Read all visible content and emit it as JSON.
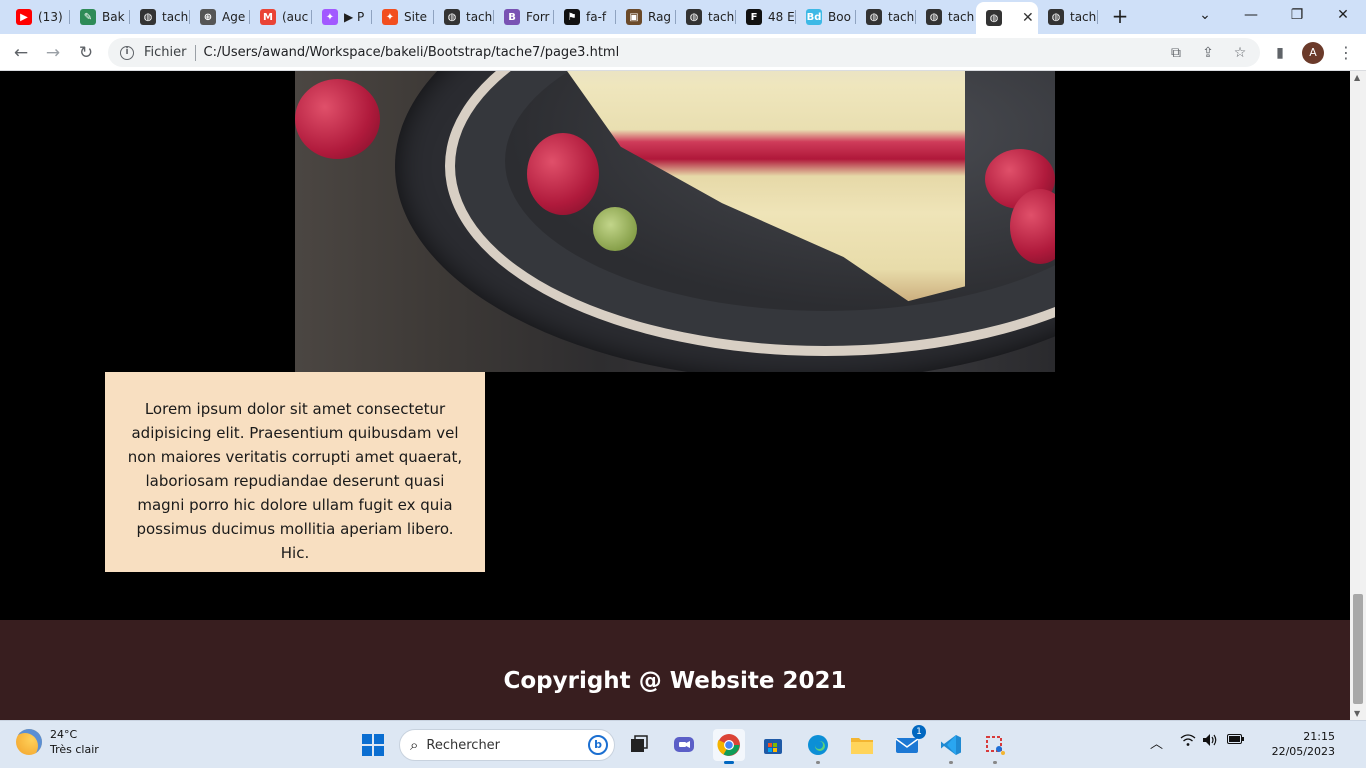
{
  "browser": {
    "tabs": [
      {
        "title": "(13)",
        "icon": "youtube-icon",
        "color": "#ff0000"
      },
      {
        "title": "Bak",
        "icon": "bakeli-icon",
        "color": "#2e8b57"
      },
      {
        "title": "tach",
        "icon": "globe-icon",
        "color": "#333333"
      },
      {
        "title": "Age",
        "icon": "web-icon",
        "color": "#333333"
      },
      {
        "title": "(auc",
        "icon": "gmail-icon",
        "color": "#ea4335"
      },
      {
        "title": "▶ P",
        "icon": "figma-icon",
        "color": "#a259ff"
      },
      {
        "title": "Site",
        "icon": "figma-icon",
        "color": "#f24e1e"
      },
      {
        "title": "tach",
        "icon": "globe-icon",
        "color": "#333333"
      },
      {
        "title": "Forr",
        "icon": "bootstrap-icon",
        "color": "#7952b3"
      },
      {
        "title": "fa-f",
        "icon": "flag-icon",
        "color": "#111111"
      },
      {
        "title": "Rag",
        "icon": "image-icon",
        "color": "#6b4a2a"
      },
      {
        "title": "tach",
        "icon": "globe-icon",
        "color": "#333333"
      },
      {
        "title": "48 E",
        "icon": "font-icon",
        "color": "#111111"
      },
      {
        "title": "Boo",
        "icon": "bd-icon",
        "color": "#3db9e6"
      },
      {
        "title": "tach",
        "icon": "globe-icon",
        "color": "#333333"
      },
      {
        "title": "tach",
        "icon": "globe-icon",
        "color": "#333333"
      },
      {
        "title": "",
        "icon": "globe-icon",
        "color": "#333333",
        "active": true
      },
      {
        "title": "tach",
        "icon": "globe-icon",
        "color": "#333333"
      }
    ],
    "address": {
      "scheme_label": "Fichier",
      "url": "C:/Users/awand/Workspace/bakeli/Bootstrap/tache7/page3.html"
    },
    "profile_initial": "A"
  },
  "page": {
    "card_text": "Lorem ipsum dolor sit amet consectetur adipisicing elit. Praesentium quibusdam vel non maiores veritatis corrupti amet quaerat, laboriosam repudiandae deserunt quasi magni porro hic dolore ullam fugit ex quia possimus ducimus mollitia aperiam libero. Hic.",
    "footer_text": "Copyright @ Website 2021",
    "colors": {
      "background": "#000000",
      "card": "#f8dfc1",
      "footer": "#381e1f"
    }
  },
  "taskbar": {
    "weather": {
      "temp": "24°C",
      "condition": "Très clair"
    },
    "search_placeholder": "Rechercher",
    "mail_badge": "1",
    "clock": {
      "time": "21:15",
      "date": "22/05/2023"
    }
  }
}
